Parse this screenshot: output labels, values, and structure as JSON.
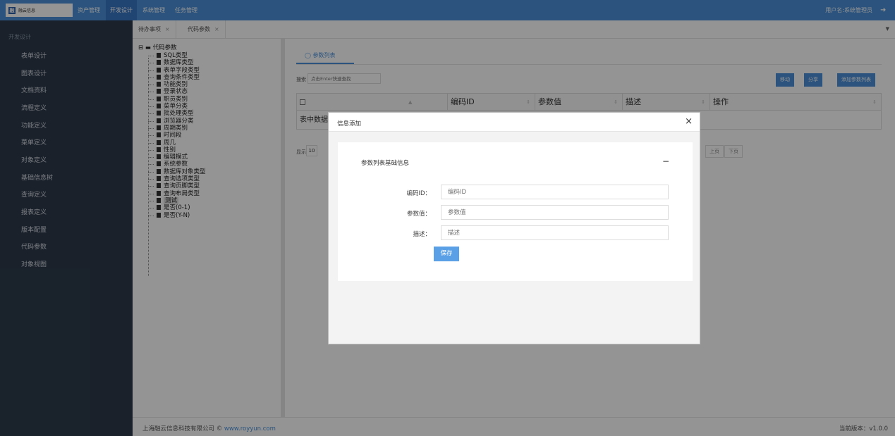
{
  "topbar": {
    "logo_mark": "融",
    "logo_text": "融云信息",
    "nav": [
      "资产管理",
      "开发设计",
      "系统管理",
      "任务管理"
    ],
    "active_nav": "开发设计",
    "user": "用户名:系统管理员"
  },
  "sidebar": {
    "title": "开发设计",
    "items": [
      "表单设计",
      "图表设计",
      "文档资料",
      "流程定义",
      "功能定义",
      "菜单定义",
      "对象定义",
      "基础信息树",
      "查询定义",
      "报表定义",
      "版本配置",
      "代码参数",
      "对象视图"
    ]
  },
  "tabs": [
    {
      "label": "待办事项",
      "close": "×"
    },
    {
      "label": "代码参数",
      "close": "×"
    }
  ],
  "tree": {
    "root": "代码参数",
    "nodes": [
      "SQL类型",
      "数据库类型",
      "表单字段类型",
      "查询条件类型",
      "功能类别",
      "登录状态",
      "职员类别",
      "菜单分类",
      "批处理类型",
      "浏览器分类",
      "周期类别",
      "时间段",
      "周几",
      "性别",
      "编辑模式",
      "系统参数",
      "数据库对象类型",
      "查询选项类型",
      "查询页脚类型",
      "查询布局类型",
      "测试",
      "是否(0-1)",
      "是否(Y-N)"
    ],
    "selected": "测试"
  },
  "panel": {
    "tab_label": "参数列表",
    "search_label": "搜索",
    "search_placeholder": "点击Enter快速查找",
    "buttons": [
      "移动",
      "分享",
      "添加参数列表"
    ],
    "columns": [
      "编码ID",
      "参数值",
      "描述",
      "操作"
    ],
    "empty_text": "表中数据",
    "pager_label": "显示",
    "page_size": "10",
    "prev": "上页",
    "next": "下页"
  },
  "footer": {
    "company": "上海融云信息科技有限公司 ©",
    "link": "www.royyun.com",
    "version": "当前版本：v1.0.0"
  },
  "modal": {
    "title": "信息添加",
    "close": "×",
    "section_title": "参数列表基础信息",
    "collapse": "−",
    "fields": [
      {
        "label": "编码ID：",
        "placeholder": "编码ID"
      },
      {
        "label": "参数值：",
        "placeholder": "参数值"
      },
      {
        "label": "描述：",
        "placeholder": "描述"
      }
    ],
    "save_label": "保存"
  },
  "colors": {
    "topbar": "#4a90d9",
    "sidebar": "#2d3a4b",
    "primary_button": "#5aa0e6"
  }
}
